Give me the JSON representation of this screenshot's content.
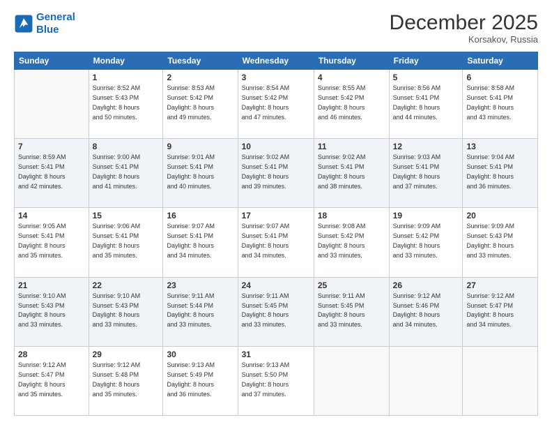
{
  "header": {
    "logo_line1": "General",
    "logo_line2": "Blue",
    "month": "December 2025",
    "location": "Korsakov, Russia"
  },
  "weekdays": [
    "Sunday",
    "Monday",
    "Tuesday",
    "Wednesday",
    "Thursday",
    "Friday",
    "Saturday"
  ],
  "weeks": [
    [
      {
        "day": "",
        "sunrise": "",
        "sunset": "",
        "daylight": ""
      },
      {
        "day": "1",
        "sunrise": "Sunrise: 8:52 AM",
        "sunset": "Sunset: 5:43 PM",
        "daylight": "Daylight: 8 hours and 50 minutes."
      },
      {
        "day": "2",
        "sunrise": "Sunrise: 8:53 AM",
        "sunset": "Sunset: 5:42 PM",
        "daylight": "Daylight: 8 hours and 49 minutes."
      },
      {
        "day": "3",
        "sunrise": "Sunrise: 8:54 AM",
        "sunset": "Sunset: 5:42 PM",
        "daylight": "Daylight: 8 hours and 47 minutes."
      },
      {
        "day": "4",
        "sunrise": "Sunrise: 8:55 AM",
        "sunset": "Sunset: 5:42 PM",
        "daylight": "Daylight: 8 hours and 46 minutes."
      },
      {
        "day": "5",
        "sunrise": "Sunrise: 8:56 AM",
        "sunset": "Sunset: 5:41 PM",
        "daylight": "Daylight: 8 hours and 44 minutes."
      },
      {
        "day": "6",
        "sunrise": "Sunrise: 8:58 AM",
        "sunset": "Sunset: 5:41 PM",
        "daylight": "Daylight: 8 hours and 43 minutes."
      }
    ],
    [
      {
        "day": "7",
        "sunrise": "Sunrise: 8:59 AM",
        "sunset": "Sunset: 5:41 PM",
        "daylight": "Daylight: 8 hours and 42 minutes."
      },
      {
        "day": "8",
        "sunrise": "Sunrise: 9:00 AM",
        "sunset": "Sunset: 5:41 PM",
        "daylight": "Daylight: 8 hours and 41 minutes."
      },
      {
        "day": "9",
        "sunrise": "Sunrise: 9:01 AM",
        "sunset": "Sunset: 5:41 PM",
        "daylight": "Daylight: 8 hours and 40 minutes."
      },
      {
        "day": "10",
        "sunrise": "Sunrise: 9:02 AM",
        "sunset": "Sunset: 5:41 PM",
        "daylight": "Daylight: 8 hours and 39 minutes."
      },
      {
        "day": "11",
        "sunrise": "Sunrise: 9:02 AM",
        "sunset": "Sunset: 5:41 PM",
        "daylight": "Daylight: 8 hours and 38 minutes."
      },
      {
        "day": "12",
        "sunrise": "Sunrise: 9:03 AM",
        "sunset": "Sunset: 5:41 PM",
        "daylight": "Daylight: 8 hours and 37 minutes."
      },
      {
        "day": "13",
        "sunrise": "Sunrise: 9:04 AM",
        "sunset": "Sunset: 5:41 PM",
        "daylight": "Daylight: 8 hours and 36 minutes."
      }
    ],
    [
      {
        "day": "14",
        "sunrise": "Sunrise: 9:05 AM",
        "sunset": "Sunset: 5:41 PM",
        "daylight": "Daylight: 8 hours and 35 minutes."
      },
      {
        "day": "15",
        "sunrise": "Sunrise: 9:06 AM",
        "sunset": "Sunset: 5:41 PM",
        "daylight": "Daylight: 8 hours and 35 minutes."
      },
      {
        "day": "16",
        "sunrise": "Sunrise: 9:07 AM",
        "sunset": "Sunset: 5:41 PM",
        "daylight": "Daylight: 8 hours and 34 minutes."
      },
      {
        "day": "17",
        "sunrise": "Sunrise: 9:07 AM",
        "sunset": "Sunset: 5:41 PM",
        "daylight": "Daylight: 8 hours and 34 minutes."
      },
      {
        "day": "18",
        "sunrise": "Sunrise: 9:08 AM",
        "sunset": "Sunset: 5:42 PM",
        "daylight": "Daylight: 8 hours and 33 minutes."
      },
      {
        "day": "19",
        "sunrise": "Sunrise: 9:09 AM",
        "sunset": "Sunset: 5:42 PM",
        "daylight": "Daylight: 8 hours and 33 minutes."
      },
      {
        "day": "20",
        "sunrise": "Sunrise: 9:09 AM",
        "sunset": "Sunset: 5:43 PM",
        "daylight": "Daylight: 8 hours and 33 minutes."
      }
    ],
    [
      {
        "day": "21",
        "sunrise": "Sunrise: 9:10 AM",
        "sunset": "Sunset: 5:43 PM",
        "daylight": "Daylight: 8 hours and 33 minutes."
      },
      {
        "day": "22",
        "sunrise": "Sunrise: 9:10 AM",
        "sunset": "Sunset: 5:43 PM",
        "daylight": "Daylight: 8 hours and 33 minutes."
      },
      {
        "day": "23",
        "sunrise": "Sunrise: 9:11 AM",
        "sunset": "Sunset: 5:44 PM",
        "daylight": "Daylight: 8 hours and 33 minutes."
      },
      {
        "day": "24",
        "sunrise": "Sunrise: 9:11 AM",
        "sunset": "Sunset: 5:45 PM",
        "daylight": "Daylight: 8 hours and 33 minutes."
      },
      {
        "day": "25",
        "sunrise": "Sunrise: 9:11 AM",
        "sunset": "Sunset: 5:45 PM",
        "daylight": "Daylight: 8 hours and 33 minutes."
      },
      {
        "day": "26",
        "sunrise": "Sunrise: 9:12 AM",
        "sunset": "Sunset: 5:46 PM",
        "daylight": "Daylight: 8 hours and 34 minutes."
      },
      {
        "day": "27",
        "sunrise": "Sunrise: 9:12 AM",
        "sunset": "Sunset: 5:47 PM",
        "daylight": "Daylight: 8 hours and 34 minutes."
      }
    ],
    [
      {
        "day": "28",
        "sunrise": "Sunrise: 9:12 AM",
        "sunset": "Sunset: 5:47 PM",
        "daylight": "Daylight: 8 hours and 35 minutes."
      },
      {
        "day": "29",
        "sunrise": "Sunrise: 9:12 AM",
        "sunset": "Sunset: 5:48 PM",
        "daylight": "Daylight: 8 hours and 35 minutes."
      },
      {
        "day": "30",
        "sunrise": "Sunrise: 9:13 AM",
        "sunset": "Sunset: 5:49 PM",
        "daylight": "Daylight: 8 hours and 36 minutes."
      },
      {
        "day": "31",
        "sunrise": "Sunrise: 9:13 AM",
        "sunset": "Sunset: 5:50 PM",
        "daylight": "Daylight: 8 hours and 37 minutes."
      },
      {
        "day": "",
        "sunrise": "",
        "sunset": "",
        "daylight": ""
      },
      {
        "day": "",
        "sunrise": "",
        "sunset": "",
        "daylight": ""
      },
      {
        "day": "",
        "sunrise": "",
        "sunset": "",
        "daylight": ""
      }
    ]
  ]
}
